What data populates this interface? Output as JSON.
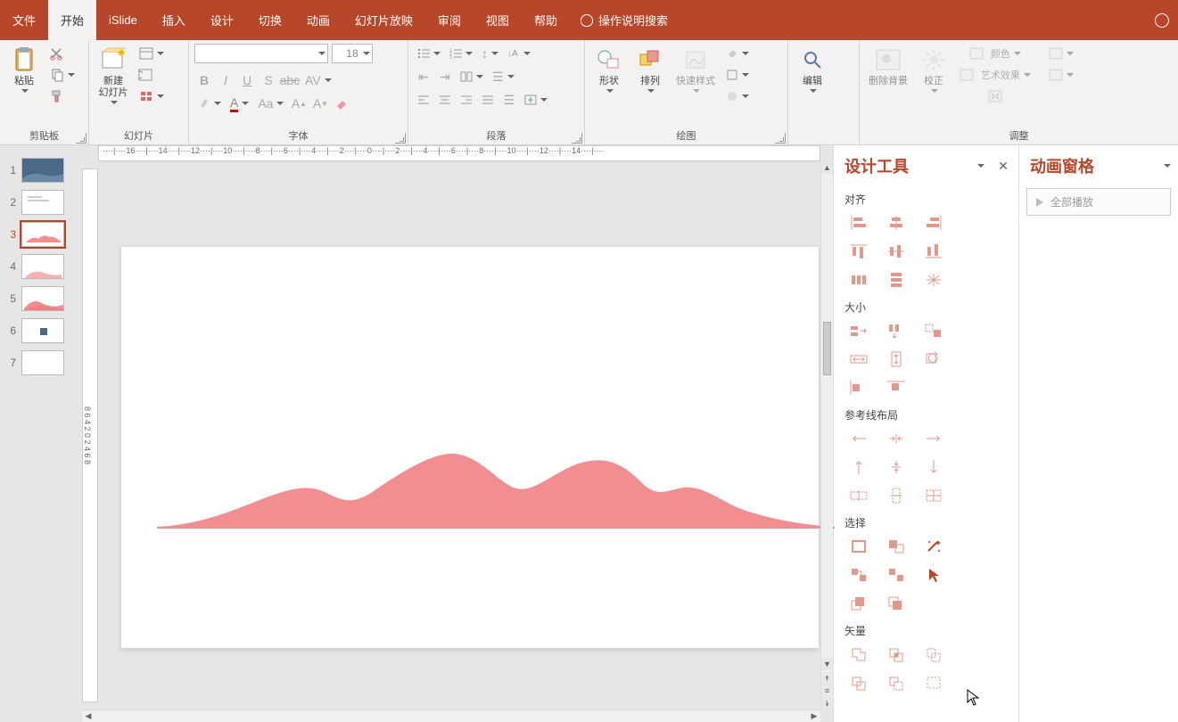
{
  "tabs": {
    "file": "文件",
    "home": "开始",
    "islide": "iSlide",
    "insert": "插入",
    "design": "设计",
    "transition": "切换",
    "animation": "动画",
    "slideshow": "幻灯片放映",
    "review": "审阅",
    "view": "视图",
    "help": "帮助",
    "tell_me": "操作说明搜索"
  },
  "ribbon": {
    "groups": {
      "clipboard": "剪贴板",
      "slides": "幻灯片",
      "font": "字体",
      "paragraph": "段落",
      "drawing": "绘图",
      "adjust": "调整"
    },
    "paste": "粘贴",
    "new_slide": "新建\n幻灯片",
    "shapes": "形状",
    "arrange": "排列",
    "quick_styles": "快速样式",
    "editing": "编辑",
    "remove_bg": "删除背景",
    "corrections": "校正",
    "color": "颜色",
    "artistic": "艺术效果",
    "font_size": "18"
  },
  "thumbnails": {
    "labels": [
      "1",
      "2",
      "3",
      "4",
      "5",
      "6",
      "7"
    ],
    "selected_index": 2
  },
  "ruler_h": "····|····16····|····14····|····12····|····10····|····8····|····6····|····4····|····2····|····0····|····2····|····4····|····6····|····8····|····10····|····12····|····14····|····",
  "ruler_v": "8  6  4  2  0  2  4  6  8",
  "design_pane": {
    "title": "设计工具",
    "sections": {
      "align": "对齐",
      "size": "大小",
      "guides": "参考线布局",
      "select": "选择",
      "vector": "矢量"
    }
  },
  "anim_pane": {
    "title": "动画窗格",
    "play_all": "全部播放"
  },
  "colors": {
    "accent": "#b7472a",
    "mountain": "#f18e92"
  }
}
